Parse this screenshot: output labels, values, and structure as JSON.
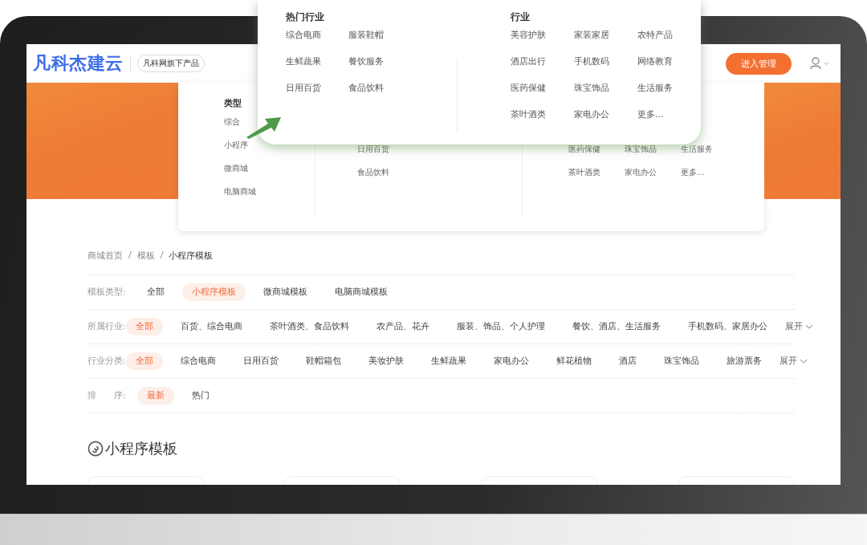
{
  "header": {
    "logo": "凡科杰建云",
    "tagline": "凡科网旗下产品",
    "manage_button": "进入管理"
  },
  "dropdown": {
    "type_title": "类型",
    "types": [
      "综合",
      "小程序",
      "微商城",
      "电脑商城"
    ],
    "hot_items": [
      "日用百货",
      "食品饮料"
    ],
    "industry_rows": [
      [
        "医药保健",
        "珠宝饰品",
        "生活服务"
      ],
      [
        "茶叶酒类",
        "家电办公",
        "更多..."
      ]
    ]
  },
  "callout": {
    "hot_title": "热门行业",
    "hot_items": [
      "综合电商",
      "服装鞋帽",
      "生鲜蔬果",
      "餐饮服务",
      "日用百货",
      "食品饮料"
    ],
    "industry_title": "行业",
    "industry_items": [
      "美容护肤",
      "家装家居",
      "农特产品",
      "酒店出行",
      "手机数码",
      "网络教育",
      "医药保健",
      "珠宝饰品",
      "生活服务",
      "茶叶酒类",
      "家电办公",
      "更多..."
    ]
  },
  "breadcrumb": {
    "separator": "/",
    "items": [
      "商城首页",
      "模板",
      "小程序模板"
    ]
  },
  "filters": [
    {
      "label": "模板类型:",
      "options": [
        {
          "label": "全部",
          "selected": false
        },
        {
          "label": "小程序模板",
          "selected": true
        },
        {
          "label": "微商城模板",
          "selected": false
        },
        {
          "label": "电脑商城模板",
          "selected": false
        }
      ]
    },
    {
      "label": "所属行业:",
      "expand": "展开",
      "options": [
        {
          "label": "全部",
          "selected": true
        },
        {
          "label": "百货、综合电商",
          "selected": false
        },
        {
          "label": "茶叶酒类、食品饮料",
          "selected": false
        },
        {
          "label": "农产品、花卉",
          "selected": false
        },
        {
          "label": "服装、饰品、个人护理",
          "selected": false
        },
        {
          "label": "餐饮、酒店、生活服务",
          "selected": false
        },
        {
          "label": "手机数码、家居办公",
          "selected": false
        }
      ]
    },
    {
      "label": "行业分类:",
      "expand": "展开",
      "options": [
        {
          "label": "全部",
          "selected": true
        },
        {
          "label": "综合电商",
          "selected": false
        },
        {
          "label": "日用百货",
          "selected": false
        },
        {
          "label": "鞋帽箱包",
          "selected": false
        },
        {
          "label": "美妆护肤",
          "selected": false
        },
        {
          "label": "生鲜蔬果",
          "selected": false
        },
        {
          "label": "家电办公",
          "selected": false
        },
        {
          "label": "鲜花植物",
          "selected": false
        },
        {
          "label": "酒店",
          "selected": false
        },
        {
          "label": "珠宝饰品",
          "selected": false
        },
        {
          "label": "旅游票务",
          "selected": false
        }
      ]
    },
    {
      "label": "排　　序:",
      "options": [
        {
          "label": "最新",
          "selected": true
        },
        {
          "label": "热门",
          "selected": false
        }
      ]
    }
  ],
  "section_title": "小程序模板"
}
